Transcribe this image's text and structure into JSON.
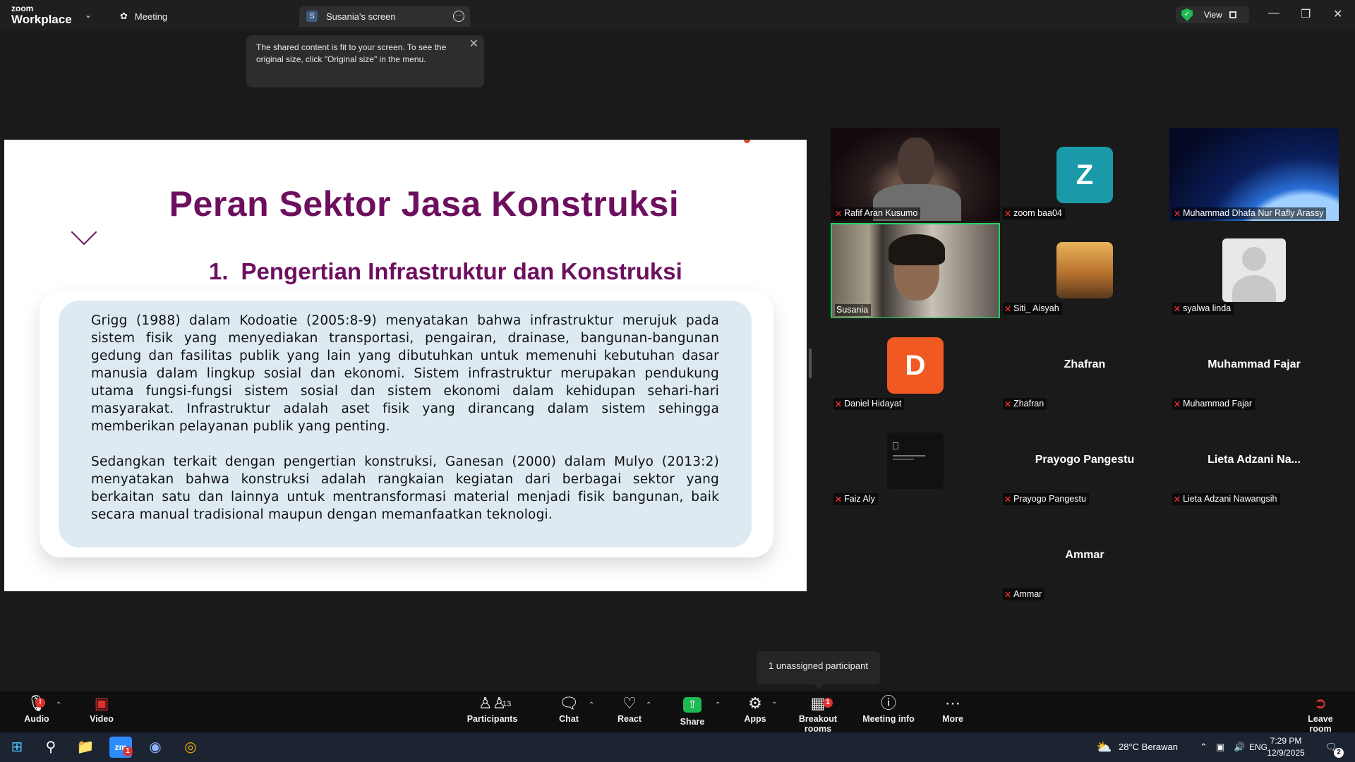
{
  "titlebar": {
    "logo_line1": "zoom",
    "logo_line2": "Workplace",
    "meeting_tab": "Meeting",
    "screen_tab_badge": "S",
    "screen_tab": "Susania's screen",
    "view_label": "View"
  },
  "notice": {
    "text": "The shared content is fit to your screen. To see the original size, click \"Original size\" in the menu."
  },
  "slide": {
    "title": "Peran Sektor Jasa Konstruksi",
    "subtitle_number": "1.",
    "subtitle": "Pengertian Infrastruktur dan Konstruksi",
    "paragraph1": "Grigg (1988) dalam Kodoatie (2005:8-9) menyatakan bahwa infrastruktur merujuk pada sistem fisik yang menyediakan transportasi, pengairan, drainase, bangunan-bangunan gedung dan fasilitas publik yang lain yang dibutuhkan untuk memenuhi kebutuhan dasar manusia dalam lingkup sosial dan ekonomi. Sistem infrastruktur merupakan pendukung utama fungsi-fungsi sistem sosial dan sistem ekonomi dalam kehidupan sehari-hari masyarakat. Infrastruktur adalah aset fisik yang dirancang dalam sistem sehingga memberikan pelayanan publik yang penting.",
    "paragraph2": "Sedangkan terkait dengan pengertian konstruksi, Ganesan (2000) dalam Mulyo (2013:2) menyatakan bahwa konstruksi adalah rangkaian kegiatan dari berbagai sektor yang berkaitan satu dan lainnya untuk mentransformasi material menjadi fisik bangunan, baik secara manual tradisional maupun dengan memanfaatkan teknologi."
  },
  "participants": [
    {
      "name": "Rafif Aran Kusumo",
      "type": "video",
      "muted": true
    },
    {
      "name": "zoom baa04",
      "type": "letter",
      "letter": "Z",
      "color": "#1a9aa8",
      "muted": true
    },
    {
      "name": "Muhammad Dhafa Nur Rafly Arassy",
      "type": "image",
      "muted": true
    },
    {
      "name": "Susania",
      "type": "video",
      "muted": false,
      "speaking": true
    },
    {
      "name": "Siti_ Aisyah",
      "type": "image",
      "muted": true
    },
    {
      "name": "syalwa linda",
      "type": "placeholder",
      "muted": true
    },
    {
      "name": "Daniel Hidayat",
      "type": "letter",
      "letter": "D",
      "color": "#f05a22",
      "muted": true
    },
    {
      "name": "Zhafran",
      "type": "name",
      "display": "Zhafran",
      "muted": true
    },
    {
      "name": "Muhammad Fajar",
      "type": "name",
      "display": "Muhammad Fajar",
      "muted": true
    },
    {
      "name": "Faiz Aly",
      "type": "image",
      "muted": true
    },
    {
      "name": "Prayogo Pangestu",
      "type": "name",
      "display": "Prayogo Pangestu",
      "muted": true
    },
    {
      "name": "Lieta Adzani Nawangsih",
      "type": "name",
      "display": "Lieta Adzani Na...",
      "muted": true
    },
    {
      "name": "Ammar",
      "type": "name",
      "display": "Ammar",
      "muted": true
    }
  ],
  "toolbar": {
    "audio": "Audio",
    "audio_badge": "!",
    "video": "Video",
    "participants": "Participants",
    "participants_count": "13",
    "chat": "Chat",
    "react": "React",
    "share": "Share",
    "apps": "Apps",
    "breakout": "Breakout rooms",
    "breakout_badge": "1",
    "meeting_info": "Meeting info",
    "more": "More",
    "leave": "Leave room"
  },
  "breakout_tooltip": "1 unassigned participant",
  "taskbar": {
    "zoom_badge": "1",
    "weather": "28°C  Berawan",
    "language": "ENG",
    "time": "7:29 PM",
    "date": "12/9/2025",
    "notif_count": "2"
  },
  "colors": {
    "slide_accent": "#6d0f5f",
    "text_box_bg": "#ddeaf1",
    "active_speaker": "#23d160",
    "mute_red": "#e0302f",
    "share_green": "#1db954"
  }
}
